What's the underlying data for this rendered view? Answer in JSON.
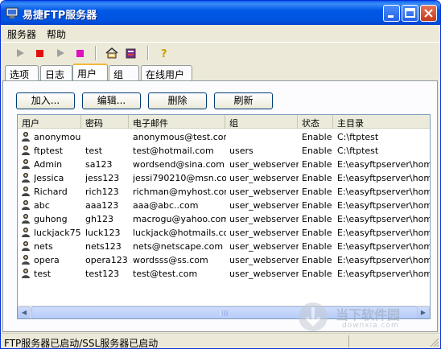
{
  "window": {
    "title": "易捷FTP服务器"
  },
  "menu": [
    {
      "label": "服务器"
    },
    {
      "label": "帮助"
    }
  ],
  "toolbar": {
    "icons": [
      "play-icon",
      "stop-icon",
      "play-icon",
      "stop-icon",
      "server-config-icon",
      "books-icon",
      "help-icon"
    ]
  },
  "tabs": [
    {
      "label": "选项"
    },
    {
      "label": "日志"
    },
    {
      "label": "用户"
    },
    {
      "label": "组"
    },
    {
      "label": "在线用户"
    }
  ],
  "actions": {
    "add": "加入...",
    "edit": "编辑...",
    "delete": "删除",
    "refresh": "刷新"
  },
  "table": {
    "columns": [
      "用户",
      "密码",
      "电子邮件",
      "组",
      "状态",
      "主目录"
    ],
    "rows": [
      {
        "user": "anonymous",
        "password": "",
        "email": "anonymous@test.com",
        "group": "",
        "status": "Enable",
        "home": "C:\\ftptest"
      },
      {
        "user": "ftptest",
        "password": "test",
        "email": "test@hotmail.com",
        "group": "users",
        "status": "Enable",
        "home": "C:\\ftptest"
      },
      {
        "user": "Admin",
        "password": "sa123",
        "email": "wordsend@sina.com",
        "group": "user_webserver",
        "status": "Enable",
        "home": "E:\\easyftpserver\\home"
      },
      {
        "user": "Jessica",
        "password": "jess123",
        "email": "jessi790210@msn.com",
        "group": "user_webserver",
        "status": "Enable",
        "home": "E:\\easyftpserver\\home"
      },
      {
        "user": "Richard",
        "password": "rich123",
        "email": "richman@myhost.com",
        "group": "user_webserver",
        "status": "Enable",
        "home": "E:\\easyftpserver\\home"
      },
      {
        "user": "abc",
        "password": "aaa123",
        "email": "aaa@abc..com",
        "group": "user_webserver",
        "status": "Enable",
        "home": "E:\\easyftpserver\\home"
      },
      {
        "user": "guhong",
        "password": "gh123",
        "email": "macrogu@yahoo.com",
        "group": "user_webserver",
        "status": "Enable",
        "home": "E:\\easyftpserver\\home"
      },
      {
        "user": "luckjack75",
        "password": "luck123",
        "email": "luckjack@hotmails.com",
        "group": "user_webserver",
        "status": "Enable",
        "home": "E:\\easyftpserver\\home"
      },
      {
        "user": "nets",
        "password": "nets123",
        "email": "nets@netscape.com",
        "group": "user_webserver",
        "status": "Enable",
        "home": "E:\\easyftpserver\\home"
      },
      {
        "user": "opera",
        "password": "opera123",
        "email": "wordsss@ss.com",
        "group": "user_webserver",
        "status": "Enable",
        "home": "E:\\easyftpserver\\home"
      },
      {
        "user": "test",
        "password": "test123",
        "email": "test@test.com",
        "group": "user_webserver",
        "status": "Enable",
        "home": "E:\\easyftpserver\\home"
      }
    ]
  },
  "status": {
    "text": "FTP服务器已启动/SSL服务器已启动"
  },
  "watermark": {
    "text": "当下软件园",
    "sub": "downxia.com"
  },
  "colors": {
    "accent": "#0058e6",
    "stop": "#e01010",
    "stop2": "#e010c0"
  }
}
